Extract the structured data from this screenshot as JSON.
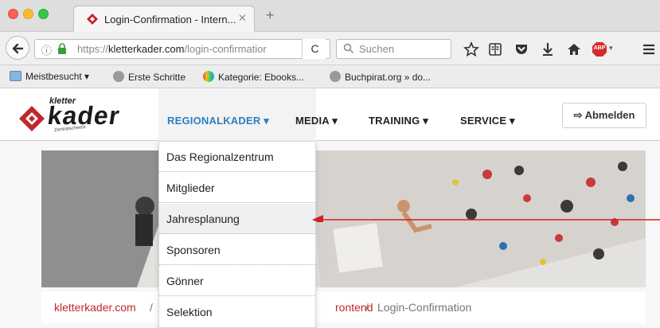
{
  "browser": {
    "tab": {
      "title": "Login-Confirmation - Intern...",
      "close": "✕"
    },
    "new_tab": "+",
    "url": {
      "prefix": "https://",
      "domain": "kletterkader.com",
      "path": "/login-confirmatior"
    },
    "reload": "C",
    "search": {
      "placeholder": "Suchen"
    },
    "bookmarks": [
      {
        "label": "Meistbesucht ▾",
        "icon": "folder-icon"
      },
      {
        "label": "Erste Schritte",
        "icon": "firefox-icon"
      },
      {
        "label": "Kategorie: Ebooks...",
        "icon": "ebook-icon"
      },
      {
        "label": "Buchpirat.org » do...",
        "icon": "globe-icon"
      }
    ],
    "adblock_badge": "ABP"
  },
  "site": {
    "logo": {
      "line1": "kletter",
      "line2": "kader",
      "sub": "Zentralschweiz"
    },
    "nav": [
      {
        "label": "REGIONALKADER ▾",
        "active": true
      },
      {
        "label": "MEDIA ▾"
      },
      {
        "label": "TRAINING ▾"
      },
      {
        "label": "SERVICE ▾"
      }
    ],
    "logout": "⇨ Abmelden",
    "dropdown": [
      "Das Regionalzentrum",
      "Mitglieder",
      "Jahresplanung",
      "Sponsoren",
      "Gönner",
      "Selektion"
    ],
    "breadcrumb": {
      "home": "kletterkader.com",
      "sep1": "/",
      "mid": "rontend",
      "sep2": "/",
      "current": "Login-Confirmation"
    },
    "colors": {
      "brand_red": "#c0272d",
      "nav_active": "#2d7fbf"
    }
  }
}
